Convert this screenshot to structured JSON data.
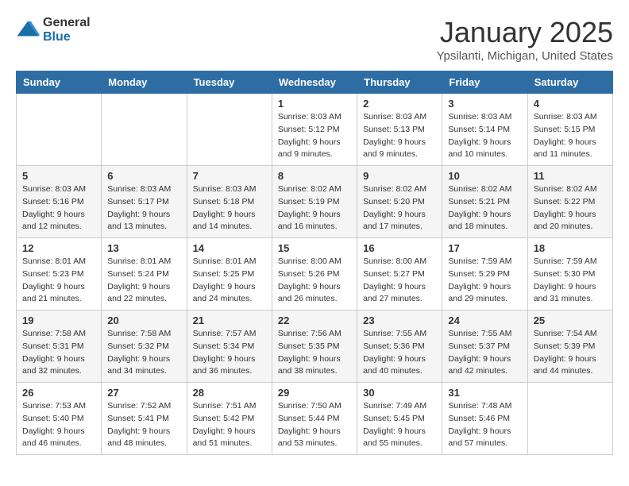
{
  "logo": {
    "general": "General",
    "blue": "Blue"
  },
  "title": "January 2025",
  "location": "Ypsilanti, Michigan, United States",
  "days_of_week": [
    "Sunday",
    "Monday",
    "Tuesday",
    "Wednesday",
    "Thursday",
    "Friday",
    "Saturday"
  ],
  "weeks": [
    [
      null,
      null,
      null,
      {
        "day": "1",
        "sunrise": "Sunrise: 8:03 AM",
        "sunset": "Sunset: 5:12 PM",
        "daylight": "Daylight: 9 hours and 9 minutes."
      },
      {
        "day": "2",
        "sunrise": "Sunrise: 8:03 AM",
        "sunset": "Sunset: 5:13 PM",
        "daylight": "Daylight: 9 hours and 9 minutes."
      },
      {
        "day": "3",
        "sunrise": "Sunrise: 8:03 AM",
        "sunset": "Sunset: 5:14 PM",
        "daylight": "Daylight: 9 hours and 10 minutes."
      },
      {
        "day": "4",
        "sunrise": "Sunrise: 8:03 AM",
        "sunset": "Sunset: 5:15 PM",
        "daylight": "Daylight: 9 hours and 11 minutes."
      }
    ],
    [
      {
        "day": "5",
        "sunrise": "Sunrise: 8:03 AM",
        "sunset": "Sunset: 5:16 PM",
        "daylight": "Daylight: 9 hours and 12 minutes."
      },
      {
        "day": "6",
        "sunrise": "Sunrise: 8:03 AM",
        "sunset": "Sunset: 5:17 PM",
        "daylight": "Daylight: 9 hours and 13 minutes."
      },
      {
        "day": "7",
        "sunrise": "Sunrise: 8:03 AM",
        "sunset": "Sunset: 5:18 PM",
        "daylight": "Daylight: 9 hours and 14 minutes."
      },
      {
        "day": "8",
        "sunrise": "Sunrise: 8:02 AM",
        "sunset": "Sunset: 5:19 PM",
        "daylight": "Daylight: 9 hours and 16 minutes."
      },
      {
        "day": "9",
        "sunrise": "Sunrise: 8:02 AM",
        "sunset": "Sunset: 5:20 PM",
        "daylight": "Daylight: 9 hours and 17 minutes."
      },
      {
        "day": "10",
        "sunrise": "Sunrise: 8:02 AM",
        "sunset": "Sunset: 5:21 PM",
        "daylight": "Daylight: 9 hours and 18 minutes."
      },
      {
        "day": "11",
        "sunrise": "Sunrise: 8:02 AM",
        "sunset": "Sunset: 5:22 PM",
        "daylight": "Daylight: 9 hours and 20 minutes."
      }
    ],
    [
      {
        "day": "12",
        "sunrise": "Sunrise: 8:01 AM",
        "sunset": "Sunset: 5:23 PM",
        "daylight": "Daylight: 9 hours and 21 minutes."
      },
      {
        "day": "13",
        "sunrise": "Sunrise: 8:01 AM",
        "sunset": "Sunset: 5:24 PM",
        "daylight": "Daylight: 9 hours and 22 minutes."
      },
      {
        "day": "14",
        "sunrise": "Sunrise: 8:01 AM",
        "sunset": "Sunset: 5:25 PM",
        "daylight": "Daylight: 9 hours and 24 minutes."
      },
      {
        "day": "15",
        "sunrise": "Sunrise: 8:00 AM",
        "sunset": "Sunset: 5:26 PM",
        "daylight": "Daylight: 9 hours and 26 minutes."
      },
      {
        "day": "16",
        "sunrise": "Sunrise: 8:00 AM",
        "sunset": "Sunset: 5:27 PM",
        "daylight": "Daylight: 9 hours and 27 minutes."
      },
      {
        "day": "17",
        "sunrise": "Sunrise: 7:59 AM",
        "sunset": "Sunset: 5:29 PM",
        "daylight": "Daylight: 9 hours and 29 minutes."
      },
      {
        "day": "18",
        "sunrise": "Sunrise: 7:59 AM",
        "sunset": "Sunset: 5:30 PM",
        "daylight": "Daylight: 9 hours and 31 minutes."
      }
    ],
    [
      {
        "day": "19",
        "sunrise": "Sunrise: 7:58 AM",
        "sunset": "Sunset: 5:31 PM",
        "daylight": "Daylight: 9 hours and 32 minutes."
      },
      {
        "day": "20",
        "sunrise": "Sunrise: 7:58 AM",
        "sunset": "Sunset: 5:32 PM",
        "daylight": "Daylight: 9 hours and 34 minutes."
      },
      {
        "day": "21",
        "sunrise": "Sunrise: 7:57 AM",
        "sunset": "Sunset: 5:34 PM",
        "daylight": "Daylight: 9 hours and 36 minutes."
      },
      {
        "day": "22",
        "sunrise": "Sunrise: 7:56 AM",
        "sunset": "Sunset: 5:35 PM",
        "daylight": "Daylight: 9 hours and 38 minutes."
      },
      {
        "day": "23",
        "sunrise": "Sunrise: 7:55 AM",
        "sunset": "Sunset: 5:36 PM",
        "daylight": "Daylight: 9 hours and 40 minutes."
      },
      {
        "day": "24",
        "sunrise": "Sunrise: 7:55 AM",
        "sunset": "Sunset: 5:37 PM",
        "daylight": "Daylight: 9 hours and 42 minutes."
      },
      {
        "day": "25",
        "sunrise": "Sunrise: 7:54 AM",
        "sunset": "Sunset: 5:39 PM",
        "daylight": "Daylight: 9 hours and 44 minutes."
      }
    ],
    [
      {
        "day": "26",
        "sunrise": "Sunrise: 7:53 AM",
        "sunset": "Sunset: 5:40 PM",
        "daylight": "Daylight: 9 hours and 46 minutes."
      },
      {
        "day": "27",
        "sunrise": "Sunrise: 7:52 AM",
        "sunset": "Sunset: 5:41 PM",
        "daylight": "Daylight: 9 hours and 48 minutes."
      },
      {
        "day": "28",
        "sunrise": "Sunrise: 7:51 AM",
        "sunset": "Sunset: 5:42 PM",
        "daylight": "Daylight: 9 hours and 51 minutes."
      },
      {
        "day": "29",
        "sunrise": "Sunrise: 7:50 AM",
        "sunset": "Sunset: 5:44 PM",
        "daylight": "Daylight: 9 hours and 53 minutes."
      },
      {
        "day": "30",
        "sunrise": "Sunrise: 7:49 AM",
        "sunset": "Sunset: 5:45 PM",
        "daylight": "Daylight: 9 hours and 55 minutes."
      },
      {
        "day": "31",
        "sunrise": "Sunrise: 7:48 AM",
        "sunset": "Sunset: 5:46 PM",
        "daylight": "Daylight: 9 hours and 57 minutes."
      },
      null
    ]
  ]
}
